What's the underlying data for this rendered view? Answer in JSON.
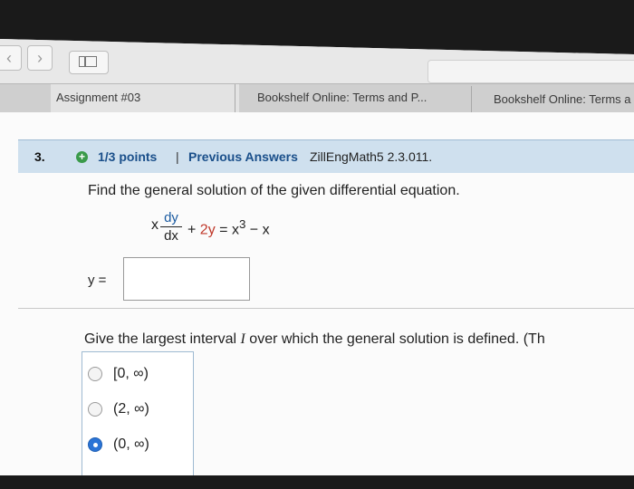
{
  "browser": {
    "tabs": [
      {
        "label": "Assignment #03",
        "active": true
      },
      {
        "label": "Bookshelf Online: Terms and P...",
        "active": false
      },
      {
        "label": "Bookshelf Online: Terms a",
        "active": false
      }
    ]
  },
  "question": {
    "number": "3.",
    "points": "1/3 points",
    "divider": "|",
    "previous_answers": "Previous Answers",
    "source": "ZillEngMath5 2.3.011.",
    "prompt": "Find the general solution of the given differential equation.",
    "equation": {
      "x": "x",
      "numerator": "dy",
      "denominator": "dx",
      "plus": " + ",
      "coef": "2y",
      "rest": " = x",
      "exp": "3",
      "tail": " − x"
    },
    "answer_label": "y =",
    "answer_value": "",
    "prompt2_before": "Give the largest interval ",
    "prompt2_var": "I",
    "prompt2_after": " over which the general solution is defined. (Th",
    "options": [
      {
        "label": "[0, ∞)",
        "selected": false
      },
      {
        "label": "(2, ∞)",
        "selected": false
      },
      {
        "label": "(0, ∞)",
        "selected": true
      }
    ]
  }
}
